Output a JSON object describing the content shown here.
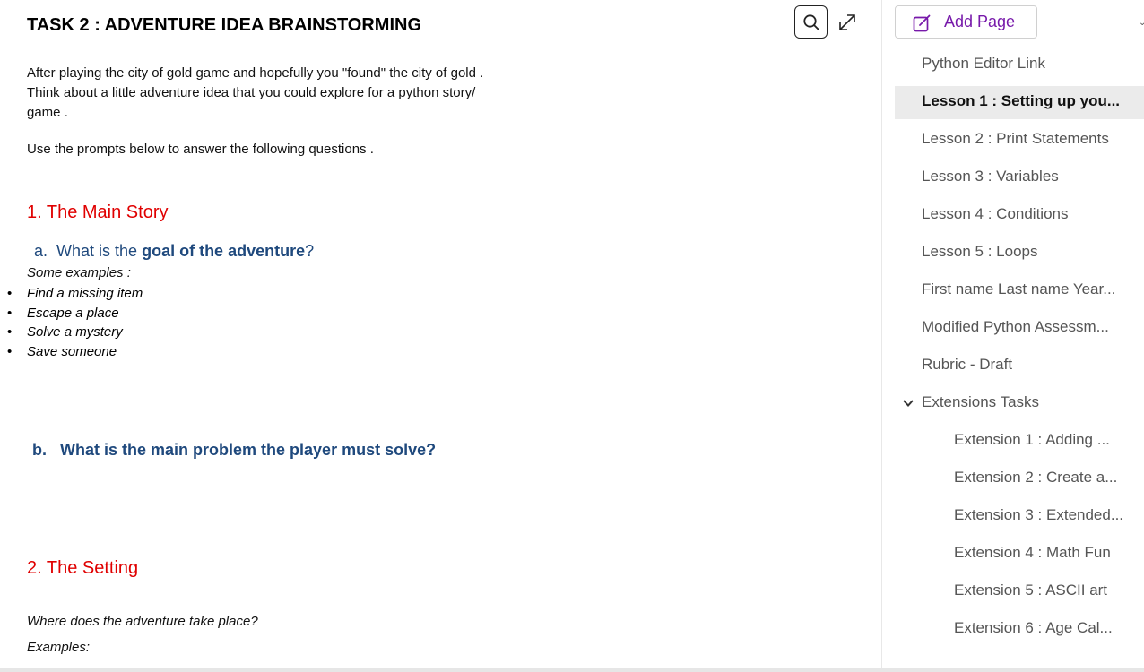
{
  "document": {
    "title": "TASK 2 : ADVENTURE IDEA BRAINSTORMING",
    "intro": "After playing the city of gold game and hopefully you \"found\" the city of gold . Think about a little adventure idea that you could explore for a python story/ game .",
    "prompt": "Use the prompts below to answer the following questions .",
    "section1_title": "1. The Main Story",
    "question_a": {
      "prefix": "a.",
      "before": "What is the ",
      "bold": "goal of the adventure",
      "after": "?"
    },
    "some_examples": "Some examples :",
    "examples": [
      "Find a missing item",
      "Escape a place",
      "Solve a mystery",
      "Save someone"
    ],
    "question_b": {
      "prefix": "b.",
      "text": "What is the main problem the player must solve?"
    },
    "section2_title": "2. The Setting",
    "where_question": "Where does the adventure take place?",
    "examples_label": "Examples:"
  },
  "toolbar": {
    "search_icon": "search-icon",
    "expand_icon": "expand-icon"
  },
  "sidebar": {
    "add_page_label": "Add Page",
    "pages": [
      {
        "label": "Python Editor Link",
        "level": 1
      },
      {
        "label": "Lesson 1 : Setting up you...",
        "level": 1,
        "selected": true
      },
      {
        "label": "Lesson 2 : Print Statements",
        "level": 1
      },
      {
        "label": "Lesson 3 : Variables",
        "level": 1
      },
      {
        "label": "Lesson 4 : Conditions",
        "level": 1
      },
      {
        "label": "Lesson 5 : Loops",
        "level": 1
      },
      {
        "label": "First name Last name Year...",
        "level": 1
      },
      {
        "label": "Modified Python Assessm...",
        "level": 1
      },
      {
        "label": "Rubric - Draft",
        "level": 1
      },
      {
        "label": "Extensions Tasks",
        "level": 1,
        "expanded": true
      },
      {
        "label": "Extension 1 : Adding ...",
        "level": 2
      },
      {
        "label": "Extension 2 : Create a...",
        "level": 2
      },
      {
        "label": "Extension 3 : Extended...",
        "level": 2
      },
      {
        "label": "Extension 4 : Math Fun",
        "level": 2
      },
      {
        "label": "Extension 5 : ASCII art",
        "level": 2
      },
      {
        "label": "Extension 6 : Age Cal...",
        "level": 2
      }
    ]
  },
  "colors": {
    "section_heading": "#e00000",
    "question": "#1f497d",
    "accent": "#7719aa"
  }
}
